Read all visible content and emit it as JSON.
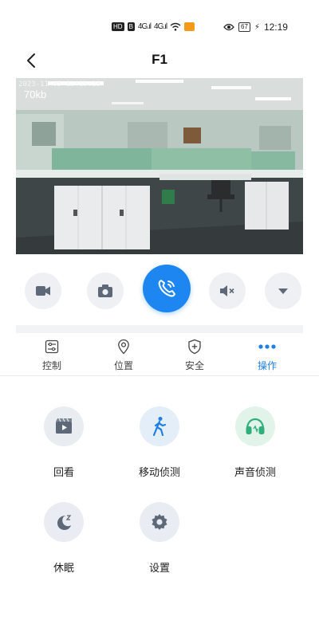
{
  "status_bar": {
    "hd_badge": "HD",
    "signal_1": "4G.ıl",
    "signal_2": "4G.ıl",
    "battery": "67",
    "time": "12:19"
  },
  "header": {
    "title": "F1"
  },
  "video": {
    "timestamp": "2023-11-05 12:19:23",
    "bitrate": "70kb"
  },
  "controls": {
    "record_icon": "video-camera-icon",
    "snapshot_icon": "camera-icon",
    "call_icon": "phone-icon",
    "mute_icon": "speaker-muted-icon",
    "more_icon": "caret-down-icon",
    "call_color": "#1e86f0"
  },
  "tabs": [
    {
      "label": "控制",
      "icon": "sliders-icon"
    },
    {
      "label": "位置",
      "icon": "location-pin-icon"
    },
    {
      "label": "安全",
      "icon": "shield-icon"
    },
    {
      "label": "操作",
      "icon": "more-dots-icon",
      "active": true
    }
  ],
  "features": [
    {
      "label": "回看",
      "icon": "playback-icon"
    },
    {
      "label": "移动侦测",
      "icon": "walking-person-icon"
    },
    {
      "label": "声音侦测",
      "icon": "headphones-icon"
    },
    {
      "label": "休眠",
      "icon": "moon-sleep-icon"
    },
    {
      "label": "设置",
      "icon": "gear-icon"
    }
  ],
  "accent_color": "#1e7fe6"
}
